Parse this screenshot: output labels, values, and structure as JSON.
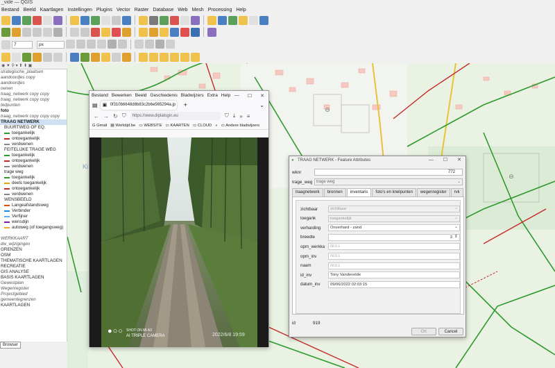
{
  "app": {
    "title": "_vide — QGIS"
  },
  "menubar": [
    "Bestand",
    "Beeld",
    "Kaartlagen",
    "Instellingen",
    "Plugins",
    "Vector",
    "Raster",
    "Database",
    "Web",
    "Mesh",
    "Processing",
    "Help"
  ],
  "toolbar": {
    "scale_value": "7",
    "unit_value": "px"
  },
  "layers": {
    "rows": [
      {
        "label": "strategische_plaatsen",
        "style": "italic",
        "sym": ""
      },
      {
        "label": "aandoordjes copy",
        "style": "italic",
        "sym": ""
      },
      {
        "label": "aandoordjes",
        "style": "italic",
        "sym": ""
      },
      {
        "label": "oenen",
        "style": "italic",
        "sym": ""
      },
      {
        "label": "traag_netwerk copy copy",
        "style": "italic",
        "sym": ""
      },
      {
        "label": "traag_netwerk copy copy",
        "style": "italic",
        "sym": ""
      },
      {
        "label": "tedpunten",
        "style": "italic",
        "sym": ""
      },
      {
        "label": "foto",
        "style": "bold",
        "sym": ""
      },
      {
        "label": "traag_netwerk copy copy copy",
        "style": "italic",
        "sym": ""
      },
      {
        "label": "TRAAG NETWERK",
        "style": "bold",
        "sym": ""
      },
      {
        "label": "BUURTWEG OF EQ.",
        "style": "",
        "sym": ""
      },
      {
        "label": "toegankelijk",
        "style": "",
        "sym": "#2e9a2e"
      },
      {
        "label": "ontoegankelijk",
        "style": "",
        "sym": "#c62828"
      },
      {
        "label": "verdwenen",
        "style": "",
        "sym": "#888888"
      },
      {
        "label": "FEITELIJKE TRAGE WEG",
        "style": "",
        "sym": ""
      },
      {
        "label": "toegankelijk",
        "style": "",
        "sym": "#2e9a2e"
      },
      {
        "label": "ontoegankelijk",
        "style": "",
        "sym": "#c62828"
      },
      {
        "label": "verdwenen",
        "style": "",
        "sym": "#888888"
      },
      {
        "label": "trage weg",
        "style": "",
        "sym": ""
      },
      {
        "label": "toegankelijk",
        "style": "",
        "sym": "#2e9a2e"
      },
      {
        "label": "deels toegankelijk",
        "style": "",
        "sym": "#e6a700"
      },
      {
        "label": "ontoegankelijk",
        "style": "",
        "sym": "#c62828"
      },
      {
        "label": "verdwenen",
        "style": "",
        "sym": "#888888"
      },
      {
        "label": "WENSBEELD",
        "style": "",
        "sym": ""
      },
      {
        "label": "Langeafstandsweg",
        "style": "",
        "sym": "#e65100"
      },
      {
        "label": "Verbinder",
        "style": "",
        "sym": "#1e88e5"
      },
      {
        "label": "Verfijner",
        "style": "",
        "sym": "#64b5f6"
      },
      {
        "label": "wensdijn",
        "style": "",
        "sym": "#7b1fa2"
      },
      {
        "label": "autoweg (of toegangsweg)",
        "style": "",
        "sym": "#f9a825"
      },
      {
        "label": "",
        "style": "",
        "sym": ""
      },
      {
        "label": "WERKKAART",
        "style": "italic",
        "sym": ""
      },
      {
        "label": "dw_wijzigingen",
        "style": "italic",
        "sym": ""
      },
      {
        "label": "GRENZEN",
        "style": "",
        "sym": ""
      },
      {
        "label": "OSM",
        "style": "",
        "sym": ""
      },
      {
        "label": "THEMATISCHE KAARTLAGEN",
        "style": "",
        "sym": ""
      },
      {
        "label": "RECREATIE",
        "style": "",
        "sym": ""
      },
      {
        "label": "GIS ANALYSE",
        "style": "",
        "sym": ""
      },
      {
        "label": "BASIS KAARTLAGEN",
        "style": "",
        "sym": ""
      },
      {
        "label": "Gewestplan",
        "style": "italic",
        "sym": ""
      },
      {
        "label": "Wegenregister",
        "style": "italic",
        "sym": ""
      },
      {
        "label": "Projectgebied",
        "style": "italic",
        "sym": ""
      },
      {
        "label": "gemeentegrenzen",
        "style": "italic",
        "sym": ""
      },
      {
        "label": "KAARTLAGEN",
        "style": "",
        "sym": ""
      }
    ],
    "browser_tab": "Browser"
  },
  "firefox": {
    "menu": [
      "Bestand",
      "Bewerken",
      "Beeld",
      "Geschiedenis",
      "Bladwijzers",
      "Extra",
      "Help"
    ],
    "tab_title": "0f310b6648d8b83c2b6e565294a.jp",
    "url": "https://www.diplalogin.eu",
    "bookmarks": [
      "Gmail",
      "Werktijd.be",
      "WEBSITE",
      "KAARTEN",
      "CLOUD",
      "Andere bladwijzers"
    ],
    "photo_watermark_1": "SHOT ON MI A3",
    "photo_watermark_2": "AI TRIPLE CAMERA",
    "photo_date": "2022/6/8  19:59"
  },
  "dialog": {
    "title": "TRAAG NETWERK - Feature Attributes",
    "wknr_label": "wknr",
    "wknr_value": "772",
    "trage_weg_label": "trage_weg",
    "trage_weg_value": "trage weg",
    "tabs": [
      "traagnetwerk",
      "bronnen",
      "inventaris",
      "foto's en knelpunten",
      "wegenregister",
      "rvk"
    ],
    "active_tab": "inventaris",
    "fields": [
      {
        "label": "zichtbaar",
        "value": "zichtbaar",
        "kind": "dis-combo"
      },
      {
        "label": "toegank",
        "value": "toegankelijk",
        "kind": "dis-combo"
      },
      {
        "label": "verharding",
        "value": "Onverhard - zand",
        "kind": "combo"
      },
      {
        "label": "breedte",
        "value": "3",
        "kind": "spin"
      },
      {
        "label": "opm_werkka",
        "value": "NULL",
        "kind": "null"
      },
      {
        "label": "opm_inv",
        "value": "NULL",
        "kind": "null"
      },
      {
        "label": "naam",
        "value": "NULL",
        "kind": "null"
      },
      {
        "label": "id_inv",
        "value": "Tony Vandevelde",
        "kind": "text"
      },
      {
        "label": "datum_inv",
        "value": "09/06/2022 02:03:15",
        "kind": "text"
      }
    ],
    "id_label": "id",
    "id_value": "919",
    "ok": "OK",
    "cancel": "Cancel"
  },
  "colors": {
    "map_bg": "#eaf2e3",
    "path_green": "#2e9a2e",
    "path_red": "#c62828",
    "forest": "#c9e3c0",
    "dialog_bg": "#f0f0f0"
  }
}
